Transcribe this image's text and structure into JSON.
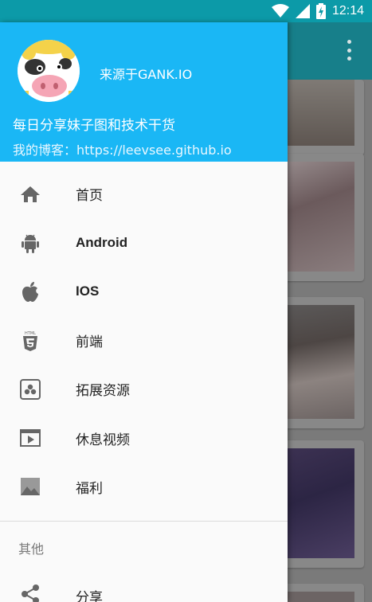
{
  "status_bar": {
    "time": "12:14"
  },
  "drawer": {
    "header": {
      "source": "来源于GANK.IO",
      "tagline": "每日分享妹子图和技术干货",
      "blog": "我的博客：https://leevsee.github.io"
    },
    "menu": [
      {
        "label": "首页",
        "icon": "home-icon",
        "bold": false
      },
      {
        "label": "Android",
        "icon": "android-icon",
        "bold": true
      },
      {
        "label": "IOS",
        "icon": "apple-icon",
        "bold": true
      },
      {
        "label": "前端",
        "icon": "html5-icon",
        "bold": false
      },
      {
        "label": "拓展资源",
        "icon": "resources-icon",
        "bold": false
      },
      {
        "label": "休息视频",
        "icon": "video-icon",
        "bold": false
      },
      {
        "label": "福利",
        "icon": "image-icon",
        "bold": false
      }
    ],
    "section_other": "其他",
    "share_label": "分享"
  },
  "colors": {
    "status_bar": "#0c9aa8",
    "drawer_header": "#1ab7f5",
    "toolbar": "#177f8a"
  }
}
